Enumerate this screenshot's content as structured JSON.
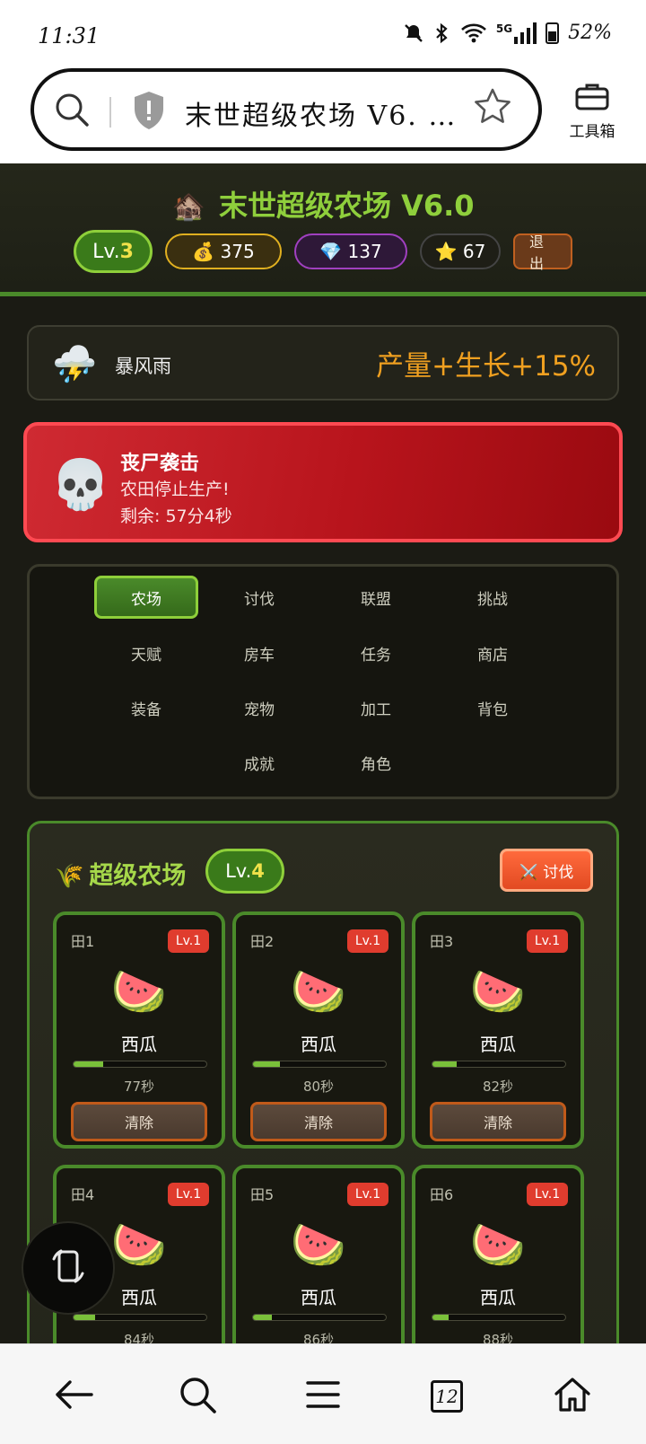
{
  "status_bar": {
    "time": "11:31",
    "network": "5G",
    "battery": "52%"
  },
  "browser": {
    "url_text": "末世超级农场 V6. …",
    "toolbox_label": "工具箱"
  },
  "game": {
    "title_icon": "🏚️",
    "title": "末世超级农场 V6.0",
    "level_prefix": "Lv.",
    "level": "3",
    "gold_icon": "💰",
    "gold": "375",
    "gem_icon": "💎",
    "gems": "137",
    "star_icon": "⭐",
    "stars": "67",
    "exit_label": "退出"
  },
  "weather": {
    "icon": "⛈️",
    "name": "暴风雨",
    "effect": "产量+生长+15%"
  },
  "alert": {
    "icon": "💀",
    "title": "丧尸袭击",
    "description": "农田停止生产!",
    "timer": "剩余: 57分4秒"
  },
  "menu": {
    "items": [
      {
        "label": "农场",
        "active": true
      },
      {
        "label": "讨伐"
      },
      {
        "label": "联盟"
      },
      {
        "label": "挑战"
      },
      {
        "label": "天赋"
      },
      {
        "label": "房车"
      },
      {
        "label": "任务"
      },
      {
        "label": "商店"
      },
      {
        "label": "装备"
      },
      {
        "label": "宠物"
      },
      {
        "label": "加工"
      },
      {
        "label": "背包"
      },
      {
        "label": "成就"
      },
      {
        "label": "角色"
      }
    ]
  },
  "farm": {
    "icon": "🌾",
    "title": "超级农场",
    "level_prefix": "Lv.",
    "level": "4",
    "attack_label": "⚔️ 讨伐",
    "plots": [
      {
        "number": "田1",
        "level": "Lv.1",
        "crop_icon": "🍉",
        "crop": "西瓜",
        "progress": 0.22,
        "time": "77秒",
        "clear_label": "清除"
      },
      {
        "number": "田2",
        "level": "Lv.1",
        "crop_icon": "🍉",
        "crop": "西瓜",
        "progress": 0.2,
        "time": "80秒",
        "clear_label": "清除"
      },
      {
        "number": "田3",
        "level": "Lv.1",
        "crop_icon": "🍉",
        "crop": "西瓜",
        "progress": 0.18,
        "time": "82秒",
        "clear_label": "清除"
      },
      {
        "number": "田4",
        "level": "Lv.1",
        "crop_icon": "🍉",
        "crop": "西瓜",
        "progress": 0.16,
        "time": "84秒"
      },
      {
        "number": "田5",
        "level": "Lv.1",
        "crop_icon": "🍉",
        "crop": "西瓜",
        "progress": 0.14,
        "time": "86秒"
      },
      {
        "number": "田6",
        "level": "Lv.1",
        "crop_icon": "🍉",
        "crop": "西瓜",
        "progress": 0.12,
        "time": "88秒"
      }
    ]
  },
  "bottom_nav": {
    "tab_count": "12"
  },
  "icons": {
    "status": [
      "mute-icon",
      "bluetooth-icon",
      "wifi-icon",
      "signal-icon",
      "battery-icon"
    ],
    "browser": [
      "search-icon",
      "shield-icon",
      "star-icon",
      "toolbox-icon"
    ],
    "nav": [
      "back-icon",
      "search-icon",
      "menu-icon",
      "tabs-icon",
      "home-icon"
    ],
    "floating": "rotate-icon"
  },
  "colors": {
    "accent_green": "#8ecf3a",
    "alert_red": "#cf2a32",
    "effect_orange": "#f0a020",
    "gold_border": "#e0b020",
    "gem_border": "#a040c0"
  }
}
